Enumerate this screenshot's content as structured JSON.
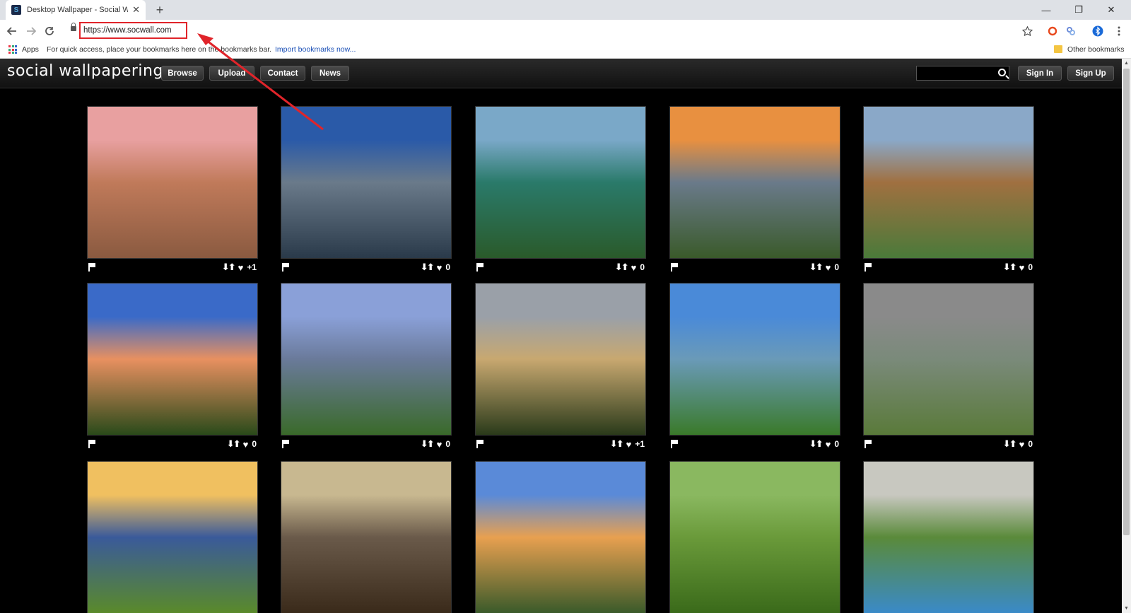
{
  "browser": {
    "tab_title": "Desktop Wallpaper - Social Wallp",
    "tab_close": "✕",
    "new_tab": "+",
    "url": "https://www.socwall.com",
    "window_controls": [
      "—",
      "❐",
      "✕"
    ],
    "bookmarks": {
      "apps_label": "Apps",
      "hint": "For quick access, place your bookmarks here on the bookmarks bar.",
      "import_link": "Import bookmarks now...",
      "other": "Other bookmarks"
    }
  },
  "site": {
    "logo": "social wallpapering",
    "nav": [
      "Browse",
      "Upload",
      "Contact",
      "News"
    ],
    "sign_in": "Sign In",
    "sign_up": "Sign Up",
    "search_placeholder": ""
  },
  "gallery": {
    "vote_arrows": "⬇⬆",
    "heart": "♥",
    "items": [
      {
        "votes": "+1",
        "scene": "lighthouse-rocks",
        "colors": [
          "#e8a0a0",
          "#c07a5a",
          "#8a5a40"
        ]
      },
      {
        "votes": "0",
        "scene": "fjord-clouds",
        "colors": [
          "#2a5aa8",
          "#6a7a8a",
          "#2a3a4a"
        ]
      },
      {
        "votes": "0",
        "scene": "mountain-lake",
        "colors": [
          "#7aa8c8",
          "#2a7a6a",
          "#2a5a2a"
        ]
      },
      {
        "votes": "0",
        "scene": "sunset-flowers",
        "colors": [
          "#e89040",
          "#6a7a8a",
          "#3a5a2a"
        ]
      },
      {
        "votes": "0",
        "scene": "rock-reflection",
        "colors": [
          "#8aa8c8",
          "#a07040",
          "#4a7a3a"
        ]
      },
      {
        "votes": "0",
        "scene": "ocean-sunset",
        "colors": [
          "#3a6ac8",
          "#e89060",
          "#2a4a1a"
        ]
      },
      {
        "votes": "0",
        "scene": "teton-lake",
        "colors": [
          "#8aa0d8",
          "#6a7a9a",
          "#3a6a2a"
        ]
      },
      {
        "votes": "+1",
        "scene": "dramatic-sky-river",
        "colors": [
          "#9aa0a8",
          "#c8a870",
          "#2a3a1a"
        ]
      },
      {
        "votes": "0",
        "scene": "glacier-lake",
        "colors": [
          "#4a8ad8",
          "#6a9ab8",
          "#3a7a2a"
        ]
      },
      {
        "votes": "0",
        "scene": "misty-lupines",
        "colors": [
          "#8a8a8a",
          "#7a8a7a",
          "#5a7a3a"
        ]
      },
      {
        "votes": "",
        "scene": "sunburst-meadow",
        "colors": [
          "#f0c060",
          "#3a5a9a",
          "#5a8a2a"
        ]
      },
      {
        "votes": "",
        "scene": "sand-dunes",
        "colors": [
          "#c8b890",
          "#6a5a4a",
          "#3a2a1a"
        ]
      },
      {
        "votes": "",
        "scene": "forest-sunset",
        "colors": [
          "#5a8ad8",
          "#e8a050",
          "#3a5a2a"
        ]
      },
      {
        "votes": "",
        "scene": "green-hills",
        "colors": [
          "#8ab860",
          "#6a9a3a",
          "#3a6a1a"
        ]
      },
      {
        "votes": "",
        "scene": "mountain-stream",
        "colors": [
          "#c8c8c0",
          "#5a8a3a",
          "#3a8ac8"
        ]
      }
    ]
  },
  "icons": {
    "back": "arrow-left-icon",
    "forward": "arrow-right-icon",
    "reload": "reload-icon",
    "star": "star-icon",
    "menu": "kebab-menu-icon"
  }
}
